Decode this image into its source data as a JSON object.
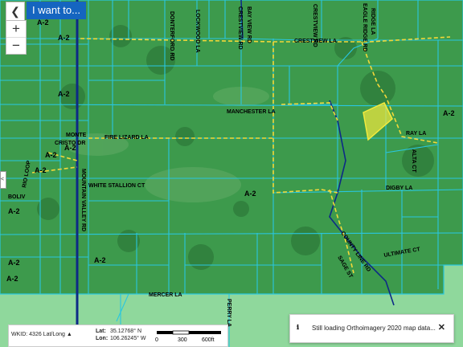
{
  "toolbar": {
    "back_icon": "chevron-left-icon",
    "i_want_to": "I want to..."
  },
  "zoom": {
    "in": "+",
    "out": "−"
  },
  "collapse_tab": "<",
  "colors": {
    "parcel_fill": "#3d9a4c",
    "parcel_line": "#29c7e0",
    "outside_fill": "#8fd89c",
    "zoning_line": "#f2d83a",
    "selected_parcel": "#f3ea3d",
    "road": "#0d2a86",
    "labels": "#000000",
    "accent_button": "#1565c0"
  },
  "map_labels": {
    "zoning": [
      "A-2",
      "A-2",
      "A-2",
      "A-2",
      "A-2",
      "A-2",
      "A-2",
      "A-2",
      "A-2",
      "A-2",
      "A-2",
      "A-2"
    ],
    "streets": {
      "crestview_la": "CRESTVIEW LA",
      "manchester_la": "MANCHESTER LA",
      "fire_lizard_la": "FIRE LIZARD LA",
      "white_stallion_ct": "WHITE STALLION CT",
      "monte_cristo_dr_1": "MONTE",
      "monte_cristo_dr_2": "CRISTO DR",
      "digby_la": "DIGBY LA",
      "county_line_rd": "COUNTY LINE RD",
      "ultimate_ct": "ULTIMATE CT",
      "mercer_la": "MERCER LA",
      "mountain_valley_rd": "MOUNTAIN VALLEY RD",
      "donterford_rd": "DONTERFORD RD",
      "lockwood_la": "LOCKWOOD LA",
      "crestview_rd_top": "CRESTVIEW RD",
      "bay_view_rd": "BAY VIEW RD",
      "crestview_rd": "CRESTVIEW RD",
      "eagle_ridge_rd": "EAGLE RIDGE RD",
      "alta_ct": "ALTA CT",
      "ray_la": "RAY LA",
      "sage_st": "SAGE ST",
      "rio_loop": "RIO LOOP",
      "bolivar": "BOLIV",
      "perry_la": "PERRY LA",
      "ridge_la": "RIDGE LA"
    }
  },
  "status_bar": {
    "wkid": "WKID: 4326 Lat/Long ▲",
    "lat_label": "Lat:",
    "lat_value": "35.12768° N",
    "lon_label": "Lon:",
    "lon_value": "106.26245° W",
    "scale_labels": [
      "0",
      "300",
      "600ft"
    ]
  },
  "toast": {
    "icon": "info-icon",
    "message": "Still loading Orthoimagery 2020 map data...",
    "close": "✕"
  }
}
